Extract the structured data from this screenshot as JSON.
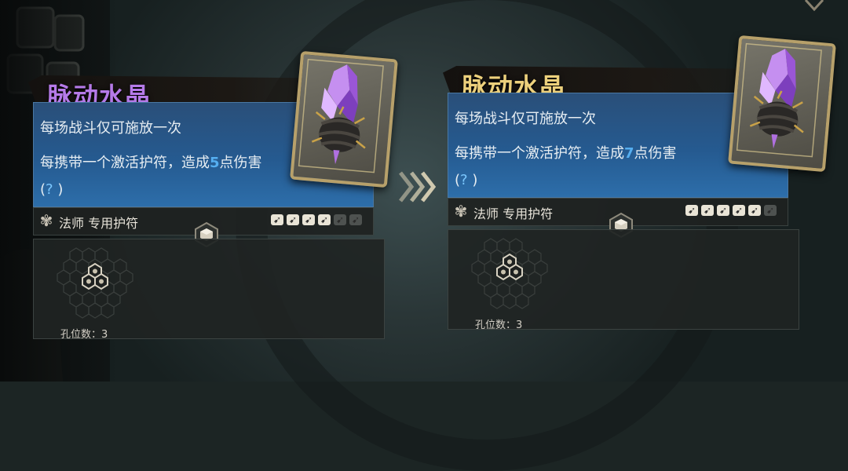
{
  "left_card": {
    "title": "脉动水晶",
    "line1": "每场战斗仅可施放一次",
    "line2_prefix": "每携带一个激活护符，造成",
    "damage": "5",
    "line2_suffix": "点伤害",
    "help_open": "(",
    "help_q": "?",
    "help_close": ")",
    "class_label": "法师 专用护符",
    "pips": {
      "filled": 4,
      "total": 6
    },
    "slot_label": "孔位数：3",
    "title_color": "#b57ae8"
  },
  "right_card": {
    "title": "脉动水晶",
    "line1": "每场战斗仅可施放一次",
    "line2_prefix": "每携带一个激活护符，造成",
    "damage": "7",
    "line2_suffix": "点伤害",
    "help_open": "(",
    "help_q": "?",
    "help_close": ")",
    "class_label": "法师 专用护符",
    "pips": {
      "filled": 5,
      "total": 6
    },
    "slot_label": "孔位数：3",
    "title_color": "#ecd07c"
  },
  "icons": {
    "upgrade_arrow": "chevron-right-triple-icon",
    "class": "mage-emblem-icon",
    "socket": "hexagon-socket-icon",
    "artwork": "purple-crystal-thorns-icon"
  },
  "colors": {
    "description_panel": "#255a90",
    "damage_number": "#55aef0",
    "card_frame": "#b7a06a"
  }
}
